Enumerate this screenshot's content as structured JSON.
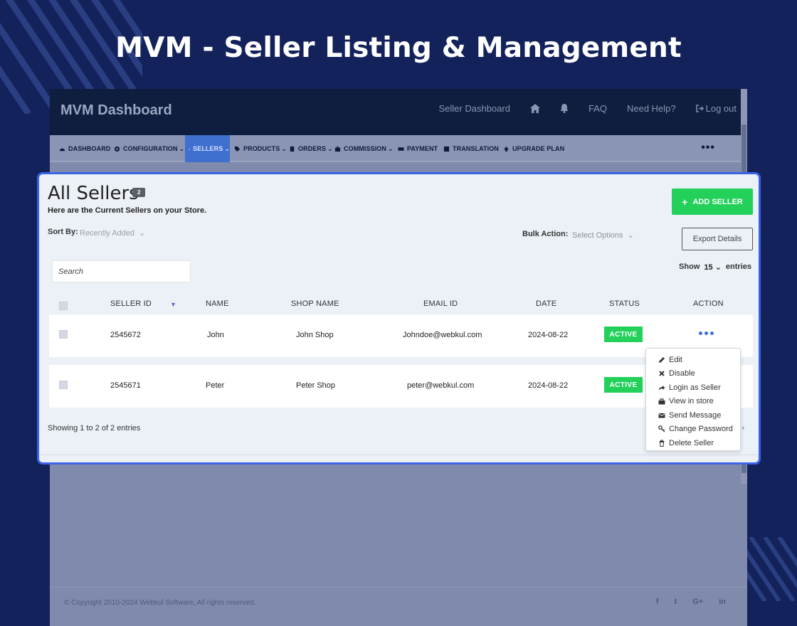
{
  "promo": {
    "title": "MVM - Seller Listing & Management"
  },
  "header": {
    "logo": "MVM Dashboard",
    "seller_dashboard": "Seller Dashboard",
    "faq": "FAQ",
    "need_help": "Need Help?",
    "logout": "Log out"
  },
  "menu": {
    "items": [
      {
        "label": "DASHBOARD",
        "icon": "dashboard-icon"
      },
      {
        "label": "CONFIGURATION",
        "icon": "gear-icon",
        "dropdown": true
      },
      {
        "label": "SELLERS",
        "icon": "users-icon",
        "dropdown": true,
        "active": true
      },
      {
        "label": "PRODUCTS",
        "icon": "tag-icon",
        "dropdown": true
      },
      {
        "label": "ORDERS",
        "icon": "clipboard-icon",
        "dropdown": true
      },
      {
        "label": "COMMISSION",
        "icon": "briefcase-icon",
        "dropdown": true
      },
      {
        "label": "PAYMENT",
        "icon": "money-icon"
      },
      {
        "label": "TRANSLATION",
        "icon": "translate-icon"
      },
      {
        "label": "UPGRADE PLAN",
        "icon": "upgrade-icon"
      }
    ],
    "more": "•••"
  },
  "page": {
    "title": "All Sellers",
    "count": "2",
    "subtitle": "Here are the Current Sellers on your Store.",
    "add_button": "ADD SELLER",
    "sort_label": "Sort By:",
    "sort_value": "Recently Added",
    "bulk_label": "Bulk Action:",
    "bulk_value": "Select Options",
    "export_button": "Export Details",
    "search_placeholder": "Search",
    "show_label": "Show",
    "show_value": "15",
    "entries_label": "entries"
  },
  "table": {
    "columns": [
      "SELLER ID",
      "NAME",
      "SHOP NAME",
      "EMAIL ID",
      "DATE",
      "STATUS",
      "ACTION"
    ],
    "rows": [
      {
        "seller_id": "2545672",
        "name": "John",
        "shop_name": "John Shop",
        "email": "Johndoe@webkul.com",
        "date": "2024-08-22",
        "status": "ACTIVE"
      },
      {
        "seller_id": "2545671",
        "name": "Peter",
        "shop_name": "Peter Shop",
        "email": "peter@webkul.com",
        "date": "2024-08-22",
        "status": "ACTIVE"
      }
    ],
    "showing": "Showing 1 to 2 of 2 entries"
  },
  "action_menu": {
    "items": [
      {
        "label": "Edit",
        "icon": "pencil-icon"
      },
      {
        "label": "Disable",
        "icon": "x-icon"
      },
      {
        "label": "Login as Seller",
        "icon": "share-arrow-icon"
      },
      {
        "label": "View in store",
        "icon": "store-icon"
      },
      {
        "label": "Send Message",
        "icon": "envelope-icon"
      },
      {
        "label": "Change Password",
        "icon": "key-icon"
      },
      {
        "label": "Delete Seller",
        "icon": "trash-icon"
      }
    ]
  },
  "footer": {
    "copyright": "© Copyright 2010-2024 Webkul Software, All rights reserved.",
    "social": [
      "f",
      "t",
      "G+",
      "in"
    ]
  },
  "colors": {
    "background": "#13225a",
    "accent": "#3a64e8",
    "success": "#22d05a",
    "topbar": "#0f1d3f"
  }
}
